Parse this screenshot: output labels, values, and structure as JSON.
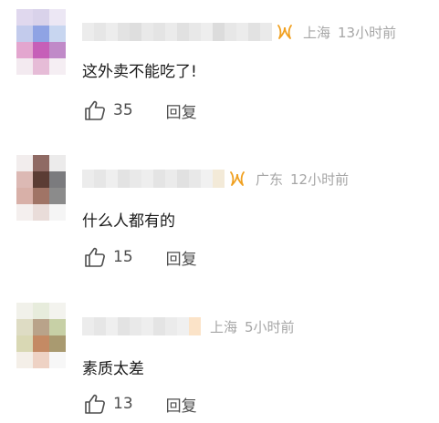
{
  "colors": {
    "meta_text": "#a6a6a6",
    "body_text": "#1a1a1a",
    "action_text": "#4d4d4d",
    "vip_badge": "#f0a020"
  },
  "comments": [
    {
      "location": "上海",
      "time": "13小时前",
      "text": "这外卖不能吃了!",
      "likes": "35",
      "reply_label": "回复",
      "has_vip_badge": true,
      "like_icon": "thumbs-up-icon",
      "badge_icon": "vip-badge-icon",
      "avatar_colors": [
        "#e0d8ee",
        "#d9d2ea",
        "#ece7f4",
        "#c3cbec",
        "#8fa3e4",
        "#c8d6f0",
        "#e3a6cf",
        "#c65fb8",
        "#c08ac8",
        "#f3eaf0",
        "#e6bcd7",
        "#f5eef3"
      ],
      "name_blur_colors": [
        "#ececec",
        "#e6e6e6",
        "#ededed",
        "#e3e3e3",
        "#dedede",
        "#e9e9e9",
        "#e4e4e4",
        "#ebebeb",
        "#e1e1e1",
        "#e8e8e8",
        "#eeeeee",
        "#dcdcdc",
        "#e7e7e7",
        "#ececec",
        "#e2e2e2",
        "#eaeaea"
      ]
    },
    {
      "location": "广东",
      "time": "12小时前",
      "text": "什么人都有的",
      "likes": "15",
      "reply_label": "回复",
      "has_vip_badge": true,
      "like_icon": "thumbs-up-icon",
      "badge_icon": "vip-badge-icon",
      "avatar_colors": [
        "#f2eded",
        "#8f6a64",
        "#ecebeb",
        "#dcb9b4",
        "#5b3c34",
        "#7b7b7e",
        "#d8b0a8",
        "#a07466",
        "#8b8b8b",
        "#f4efee",
        "#e9dcd9",
        "#f5f5f5"
      ],
      "name_blur_colors": [
        "#ececec",
        "#e6e6e6",
        "#efefef",
        "#e3e3e3",
        "#e9e9e9",
        "#eeeeee",
        "#e4e4e4",
        "#ebebeb",
        "#e1e1e1",
        "#e8e8e8",
        "#f1f1f1",
        "#f3ead8"
      ]
    },
    {
      "location": "上海",
      "time": "5小时前",
      "text": "素质太差",
      "likes": "13",
      "reply_label": "回复",
      "has_vip_badge": false,
      "like_icon": "thumbs-up-icon",
      "badge_icon": "",
      "avatar_colors": [
        "#f1f1ea",
        "#e7ecdc",
        "#f3f3ee",
        "#dedcc4",
        "#b9a38a",
        "#c7d0a6",
        "#d9d8b4",
        "#c48a64",
        "#a99a70",
        "#f4efe8",
        "#eed2c4",
        "#f7f7f7"
      ],
      "name_blur_colors": [
        "#ececec",
        "#e6e6e6",
        "#efefef",
        "#e3e3e3",
        "#e9e9e9",
        "#eeeeee",
        "#e4e4e4",
        "#ebebeb",
        "#f0f0f0",
        "#fbe3c8"
      ]
    }
  ]
}
